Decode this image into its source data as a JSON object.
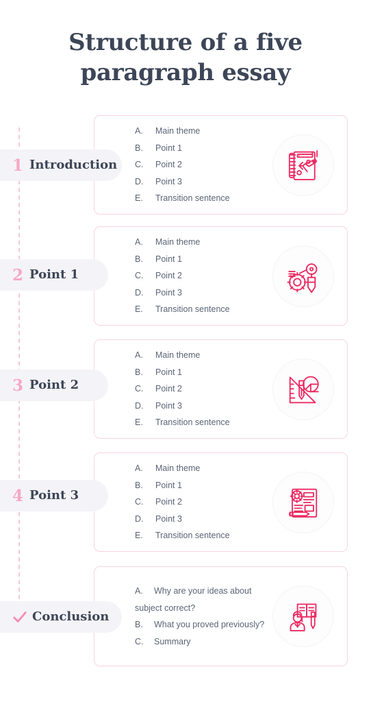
{
  "title": "Structure of a five paragraph essay",
  "colors": {
    "title_text": "#3d4657",
    "accent_pink": "#ec2a62",
    "soft_pink": "#f7a8c4",
    "card_border": "#fbd3e0",
    "pill_bg": "#f4f4f8",
    "list_text": "#5b6476"
  },
  "rows": [
    {
      "number": "1",
      "label": "Introduction",
      "icon": "notebook-pencil-idea-icon",
      "items": [
        {
          "letter": "A.",
          "text": "Main theme"
        },
        {
          "letter": "B.",
          "text": "Point 1"
        },
        {
          "letter": "C.",
          "text": "Point 2"
        },
        {
          "letter": "D.",
          "text": "Point 3"
        },
        {
          "letter": "E.",
          "text": "Transition sentence"
        }
      ]
    },
    {
      "number": "2",
      "label": "Point 1",
      "icon": "gear-pencil-lightbulb-icon",
      "items": [
        {
          "letter": "A.",
          "text": "Main theme"
        },
        {
          "letter": "B.",
          "text": "Point 1"
        },
        {
          "letter": "C.",
          "text": "Point 2"
        },
        {
          "letter": "D.",
          "text": "Point 3"
        },
        {
          "letter": "E.",
          "text": "Transition sentence"
        }
      ]
    },
    {
      "number": "3",
      "label": "Point 2",
      "icon": "ruler-pencil-piechart-icon",
      "items": [
        {
          "letter": "A.",
          "text": "Main theme"
        },
        {
          "letter": "B.",
          "text": "Point 1"
        },
        {
          "letter": "C.",
          "text": "Point 2"
        },
        {
          "letter": "D.",
          "text": "Point 3"
        },
        {
          "letter": "E.",
          "text": "Transition sentence"
        }
      ]
    },
    {
      "number": "4",
      "label": "Point 3",
      "icon": "document-gear-pencil-icon",
      "items": [
        {
          "letter": "A.",
          "text": "Main theme"
        },
        {
          "letter": "B.",
          "text": "Point 1"
        },
        {
          "letter": "C.",
          "text": "Point 2"
        },
        {
          "letter": "D.",
          "text": "Point 3"
        },
        {
          "letter": "E.",
          "text": "Transition sentence"
        }
      ]
    },
    {
      "number": "",
      "label": "Conclusion",
      "icon": "student-book-pen-icon",
      "marker": "check-icon",
      "items": [
        {
          "letter": "A.",
          "text": "Why are your ideas about subject correct?"
        },
        {
          "letter": "B.",
          "text": "What you proved previously?"
        },
        {
          "letter": "C.",
          "text": "Summary"
        }
      ]
    }
  ]
}
